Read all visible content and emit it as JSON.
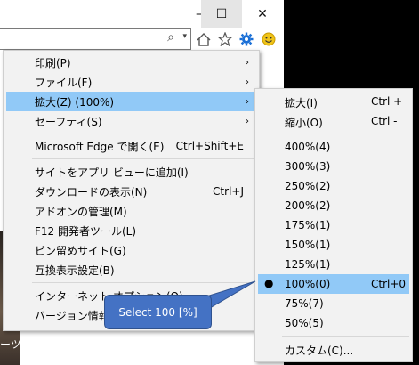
{
  "window": {
    "min_glyph": "—",
    "max_glyph": "☐",
    "close_glyph": "✕"
  },
  "address_bar": {
    "search_glyph": "⌕",
    "dropdown_glyph": "▾"
  },
  "toolbar_icons": [
    "home-icon",
    "favorites-star-icon",
    "gear-icon",
    "feedback-smiley-icon"
  ],
  "background_text": "ーツ",
  "menu": {
    "items": [
      {
        "label": "印刷(P)",
        "shortcut": "",
        "arrow": "›"
      },
      {
        "label": "ファイル(F)",
        "shortcut": "",
        "arrow": "›"
      },
      {
        "label": "拡大(Z) (100%)",
        "shortcut": "",
        "arrow": "›"
      },
      {
        "label": "セーフティ(S)",
        "shortcut": "",
        "arrow": "›"
      },
      {
        "label": "Microsoft Edge で開く(E)",
        "shortcut": "Ctrl+Shift+E",
        "arrow": ""
      },
      {
        "label": "サイトをアプリ ビューに追加(I)",
        "shortcut": "",
        "arrow": ""
      },
      {
        "label": "ダウンロードの表示(N)",
        "shortcut": "Ctrl+J",
        "arrow": ""
      },
      {
        "label": "アドオンの管理(M)",
        "shortcut": "",
        "arrow": ""
      },
      {
        "label": "F12 開発者ツール(L)",
        "shortcut": "",
        "arrow": ""
      },
      {
        "label": "ピン留めサイト(G)",
        "shortcut": "",
        "arrow": ""
      },
      {
        "label": "互換表示設定(B)",
        "shortcut": "",
        "arrow": ""
      },
      {
        "label": "インターネット オプション(O)",
        "shortcut": "",
        "arrow": ""
      },
      {
        "label": "バージョン情報(A)",
        "shortcut": "",
        "arrow": ""
      }
    ]
  },
  "zoom_submenu": {
    "items": [
      {
        "label": "拡大(I)",
        "shortcut": "Ctrl +"
      },
      {
        "label": "縮小(O)",
        "shortcut": "Ctrl -"
      },
      {
        "label": "400%(4)",
        "shortcut": ""
      },
      {
        "label": "300%(3)",
        "shortcut": ""
      },
      {
        "label": "250%(2)",
        "shortcut": ""
      },
      {
        "label": "200%(2)",
        "shortcut": ""
      },
      {
        "label": "175%(1)",
        "shortcut": ""
      },
      {
        "label": "150%(1)",
        "shortcut": ""
      },
      {
        "label": "125%(1)",
        "shortcut": ""
      },
      {
        "label": "100%(0)",
        "shortcut": "Ctrl+0"
      },
      {
        "label": "75%(7)",
        "shortcut": ""
      },
      {
        "label": "50%(5)",
        "shortcut": ""
      },
      {
        "label": "カスタム(C)...",
        "shortcut": ""
      }
    ],
    "selected_bullet": "●"
  },
  "callout": {
    "text": "Select 100 [%]"
  },
  "colors": {
    "highlight": "#91c9f7",
    "callout": "#4472c4",
    "gear": "#1a6fd6",
    "smiley": "#f0c419"
  }
}
